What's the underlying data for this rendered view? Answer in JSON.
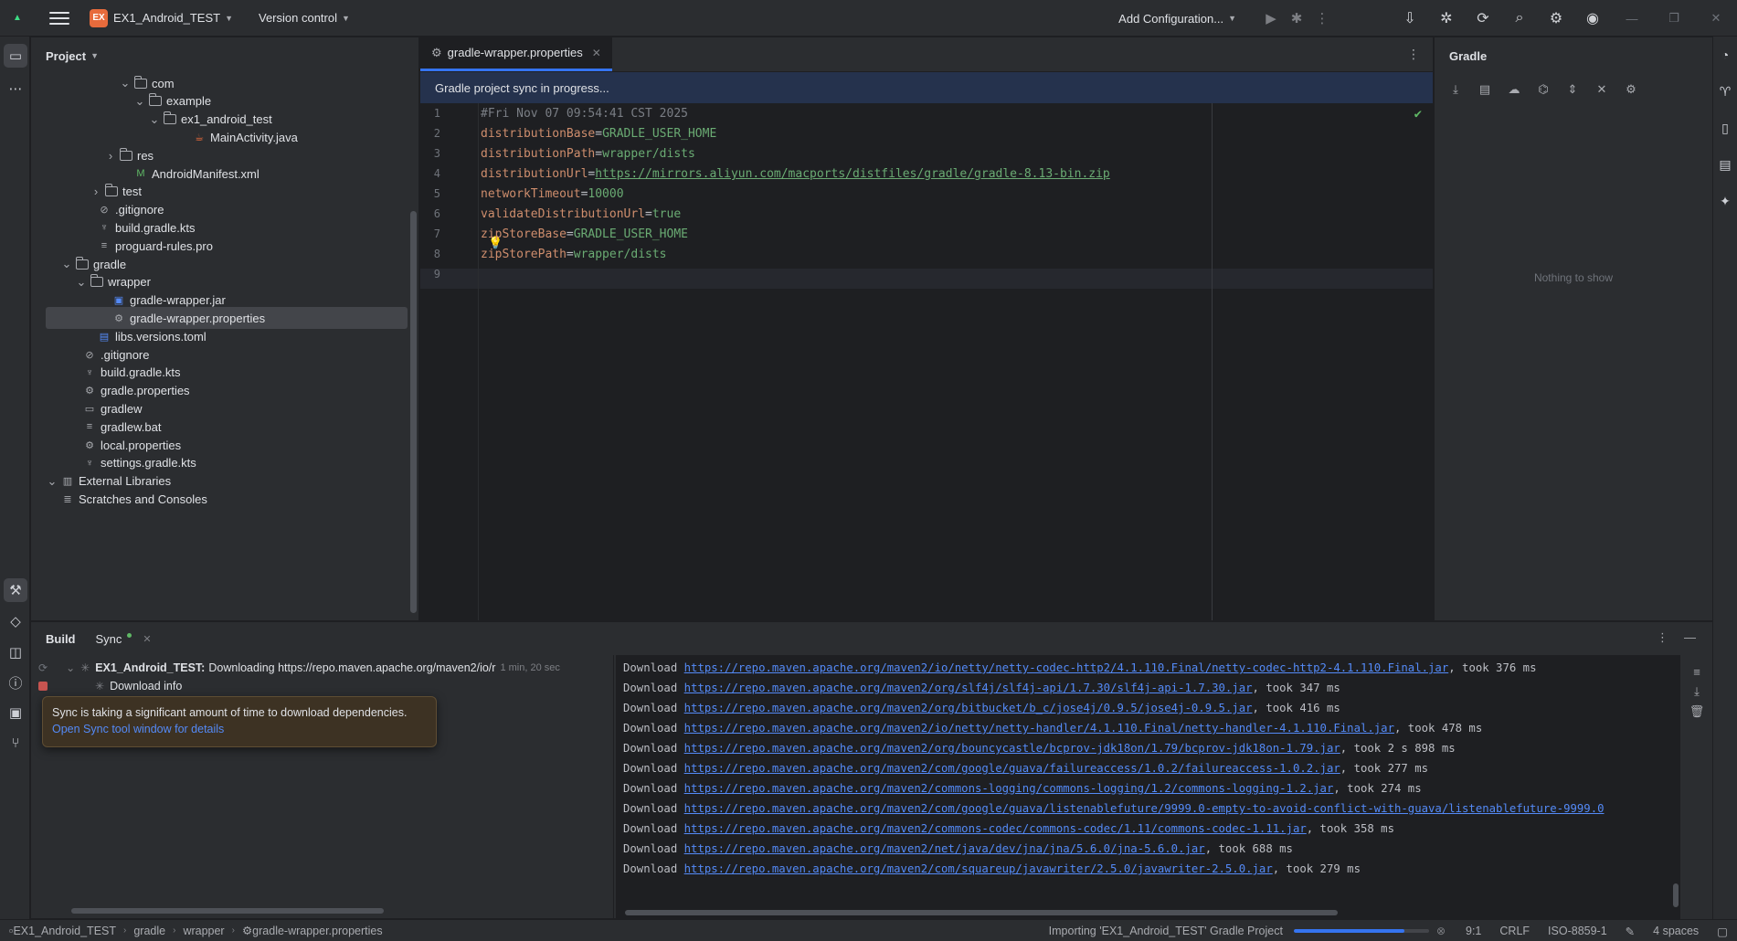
{
  "titlebar": {
    "project_badge": "EX",
    "project_name": "EX1_Android_TEST",
    "version_control": "Version control",
    "run_config": "Add Configuration..."
  },
  "project_panel": {
    "title": "Project",
    "tree": [
      {
        "label": "com",
        "kind": "folder",
        "expanded": true
      },
      {
        "label": "example",
        "kind": "folder",
        "expanded": true
      },
      {
        "label": "ex1_android_test",
        "kind": "folder",
        "expanded": true
      },
      {
        "label": "MainActivity.java",
        "kind": "java"
      },
      {
        "label": "res",
        "kind": "folder",
        "expanded": false
      },
      {
        "label": "AndroidManifest.xml",
        "kind": "manifest"
      },
      {
        "label": "test",
        "kind": "folder",
        "expanded": false
      },
      {
        "label": ".gitignore",
        "kind": "ignore"
      },
      {
        "label": "build.gradle.kts",
        "kind": "gradle"
      },
      {
        "label": "proguard-rules.pro",
        "kind": "text"
      },
      {
        "label": "gradle",
        "kind": "folder",
        "expanded": true
      },
      {
        "label": "wrapper",
        "kind": "folder",
        "expanded": true
      },
      {
        "label": "gradle-wrapper.jar",
        "kind": "jar"
      },
      {
        "label": "gradle-wrapper.properties",
        "kind": "settings",
        "selected": true
      },
      {
        "label": "libs.versions.toml",
        "kind": "toml"
      },
      {
        "label": ".gitignore",
        "kind": "ignore"
      },
      {
        "label": "build.gradle.kts",
        "kind": "gradle"
      },
      {
        "label": "gradle.properties",
        "kind": "settings"
      },
      {
        "label": "gradlew",
        "kind": "script"
      },
      {
        "label": "gradlew.bat",
        "kind": "text"
      },
      {
        "label": "local.properties",
        "kind": "settings"
      },
      {
        "label": "settings.gradle.kts",
        "kind": "gradle"
      },
      {
        "label": "External Libraries",
        "kind": "library",
        "expanded": true
      },
      {
        "label": "Scratches and Consoles",
        "kind": "scratches"
      }
    ]
  },
  "editor": {
    "tab_label": "gradle-wrapper.properties",
    "banner": "Gradle project sync in progress...",
    "lines": [
      {
        "n": "1",
        "comment": "#Fri Nov 07 09:54:41 CST 2025"
      },
      {
        "n": "2",
        "key": "distributionBase",
        "value": "GRADLE_USER_HOME"
      },
      {
        "n": "3",
        "key": "distributionPath",
        "value": "wrapper/dists"
      },
      {
        "n": "4",
        "key": "distributionUrl",
        "value": "https://mirrors.aliyun.com/macports/distfiles/gradle/gradle-8.13-bin.zip",
        "link": true
      },
      {
        "n": "5",
        "key": "networkTimeout",
        "value": "10000"
      },
      {
        "n": "6",
        "key": "validateDistributionUrl",
        "value": "true"
      },
      {
        "n": "7",
        "key": "zipStoreBase",
        "value": "GRADLE_USER_HOME"
      },
      {
        "n": "8",
        "key": "zipStorePath",
        "value": "wrapper/dists"
      },
      {
        "n": "9"
      }
    ]
  },
  "gradle_panel": {
    "title": "Gradle",
    "empty_text": "Nothing to show"
  },
  "build_panel": {
    "title": "Build",
    "tab_label": "Sync",
    "sync_project": "EX1_Android_TEST:",
    "sync_status": "Downloading https://repo.maven.apache.org/maven2/io/r",
    "sync_time": "1 min, 20 sec",
    "download_info": "Download info",
    "console_prefix": "Download",
    "console_lines": [
      {
        "url": "https://repo.maven.apache.org/maven2/io/netty/netty-codec-http2/4.1.110.Final/netty-codec-http2-4.1.110.Final.jar",
        "took": ", took 376 ms"
      },
      {
        "url": "https://repo.maven.apache.org/maven2/org/slf4j/slf4j-api/1.7.30/slf4j-api-1.7.30.jar",
        "took": ", took 347 ms"
      },
      {
        "url": "https://repo.maven.apache.org/maven2/org/bitbucket/b_c/jose4j/0.9.5/jose4j-0.9.5.jar",
        "took": ", took 416 ms"
      },
      {
        "url": "https://repo.maven.apache.org/maven2/io/netty/netty-handler/4.1.110.Final/netty-handler-4.1.110.Final.jar",
        "took": ", took 478 ms"
      },
      {
        "url": "https://repo.maven.apache.org/maven2/org/bouncycastle/bcprov-jdk18on/1.79/bcprov-jdk18on-1.79.jar",
        "took": ", took 2 s 898 ms"
      },
      {
        "url": "https://repo.maven.apache.org/maven2/com/google/guava/failureaccess/1.0.2/failureaccess-1.0.2.jar",
        "took": ", took 277 ms"
      },
      {
        "url": "https://repo.maven.apache.org/maven2/commons-logging/commons-logging/1.2/commons-logging-1.2.jar",
        "took": ", took 274 ms"
      },
      {
        "url": "https://repo.maven.apache.org/maven2/com/google/guava/listenablefuture/9999.0-empty-to-avoid-conflict-with-guava/listenablefuture-9999.0",
        "took": ""
      },
      {
        "url": "https://repo.maven.apache.org/maven2/commons-codec/commons-codec/1.11/commons-codec-1.11.jar",
        "took": ", took 358 ms"
      },
      {
        "url": "https://repo.maven.apache.org/maven2/net/java/dev/jna/jna/5.6.0/jna-5.6.0.jar",
        "took": ", took 688 ms"
      },
      {
        "url": "https://repo.maven.apache.org/maven2/com/squareup/javawriter/2.5.0/javawriter-2.5.0.jar",
        "took": ", took 279 ms"
      }
    ]
  },
  "tooltip": {
    "text": "Sync is taking a significant amount of time to download dependencies.",
    "link": "Open Sync tool window for details"
  },
  "statusbar": {
    "breadcrumb": [
      "EX1_Android_TEST",
      "gradle",
      "wrapper",
      "gradle-wrapper.properties"
    ],
    "task": "Importing 'EX1_Android_TEST' Gradle Project",
    "progress": 0.82,
    "position": "9:1",
    "line_sep": "CRLF",
    "encoding": "ISO-8859-1",
    "indent": "4 spaces"
  },
  "colors": {
    "accent": "#3574f0",
    "link": "#548af7",
    "string": "#6aab73",
    "key": "#cf8e6d",
    "ok": "#5fb865",
    "project_badge": "#e76b3c"
  }
}
